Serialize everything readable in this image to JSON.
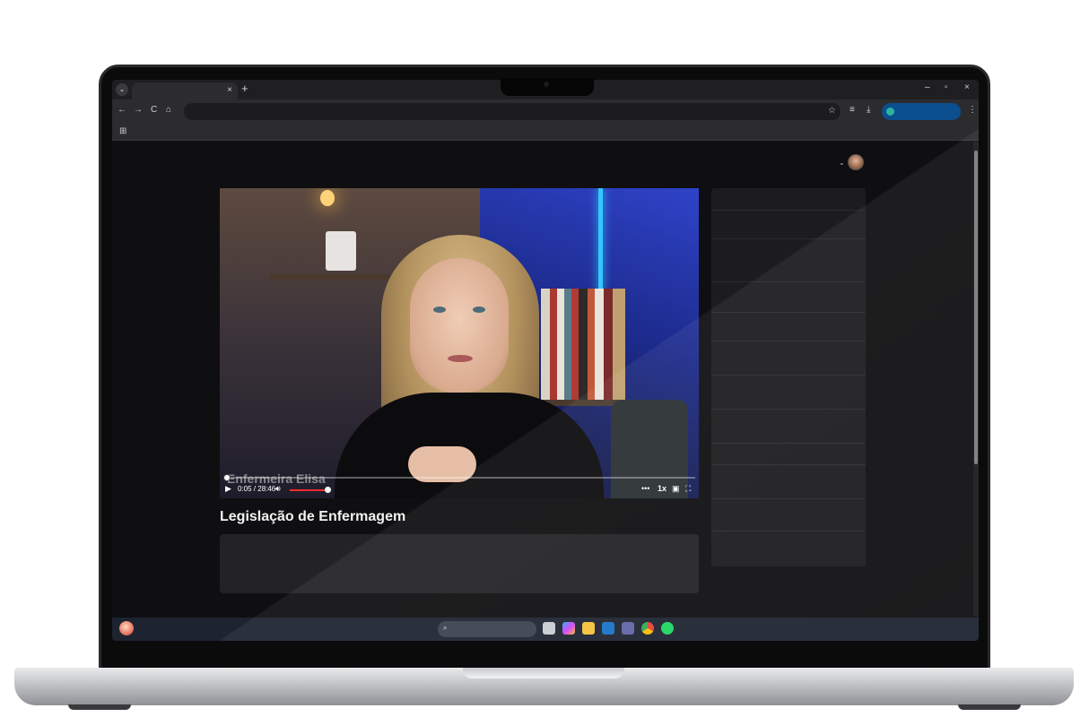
{
  "browser": {
    "tab_close": "×",
    "new_tab": "+",
    "minimize": "–",
    "restore": "▫",
    "close": "×"
  },
  "nav": {
    "back": "←",
    "forward": "→",
    "reload": "C",
    "home": "⌂"
  },
  "video": {
    "watermark": "Enfermeira Elisa",
    "time": "0:05 / 28:46",
    "progress_fraction": 0.003,
    "volume_fraction": 0.9,
    "speed": "1x",
    "more": "•••",
    "play_icon": "play-icon",
    "title": "Legislação de Enfermagem"
  },
  "taskbar": {
    "apps": [
      "file-explorer",
      "copilot",
      "folder",
      "outlook",
      "teams",
      "chrome",
      "spotify"
    ]
  },
  "colors": {
    "progress": "#ff2d2d",
    "profile_pill": "#0b4f8f",
    "page_bg": "#0f0f11"
  }
}
